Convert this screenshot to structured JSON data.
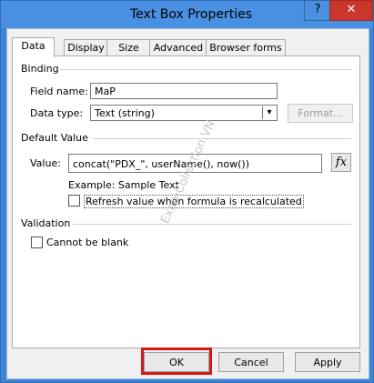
{
  "window": {
    "title": "Text Box Properties",
    "help_label": "?",
    "close_label": "✕"
  },
  "tabs": [
    {
      "label": "Data",
      "active": true
    },
    {
      "label": "Display",
      "active": false
    },
    {
      "label": "Size",
      "active": false
    },
    {
      "label": "Advanced",
      "active": false
    },
    {
      "label": "Browser forms",
      "active": false
    }
  ],
  "binding": {
    "group_label": "Binding",
    "field_name_label": "Field name:",
    "field_name_value": "MaP",
    "data_type_label": "Data type:",
    "data_type_value": "Text (string)",
    "format_button": "Format..."
  },
  "default_value": {
    "group_label": "Default Value",
    "value_label": "Value:",
    "formula": "concat(\"PDX_\", userName(), now())",
    "fx_label": "fx",
    "example_text": "Example: Sample Text",
    "refresh_label": "Refresh value when formula is recalculated",
    "refresh_checked": false
  },
  "validation": {
    "group_label": "Validation",
    "cannot_be_blank_label": "Cannot be blank",
    "cannot_be_blank_checked": false
  },
  "buttons": {
    "ok": "OK",
    "cancel": "Cancel",
    "apply": "Apply"
  },
  "watermark": "ExamCollection.VN",
  "colors": {
    "titlebar": "#4a90e2",
    "close": "#c9372c",
    "highlight": "#d31a1a"
  }
}
